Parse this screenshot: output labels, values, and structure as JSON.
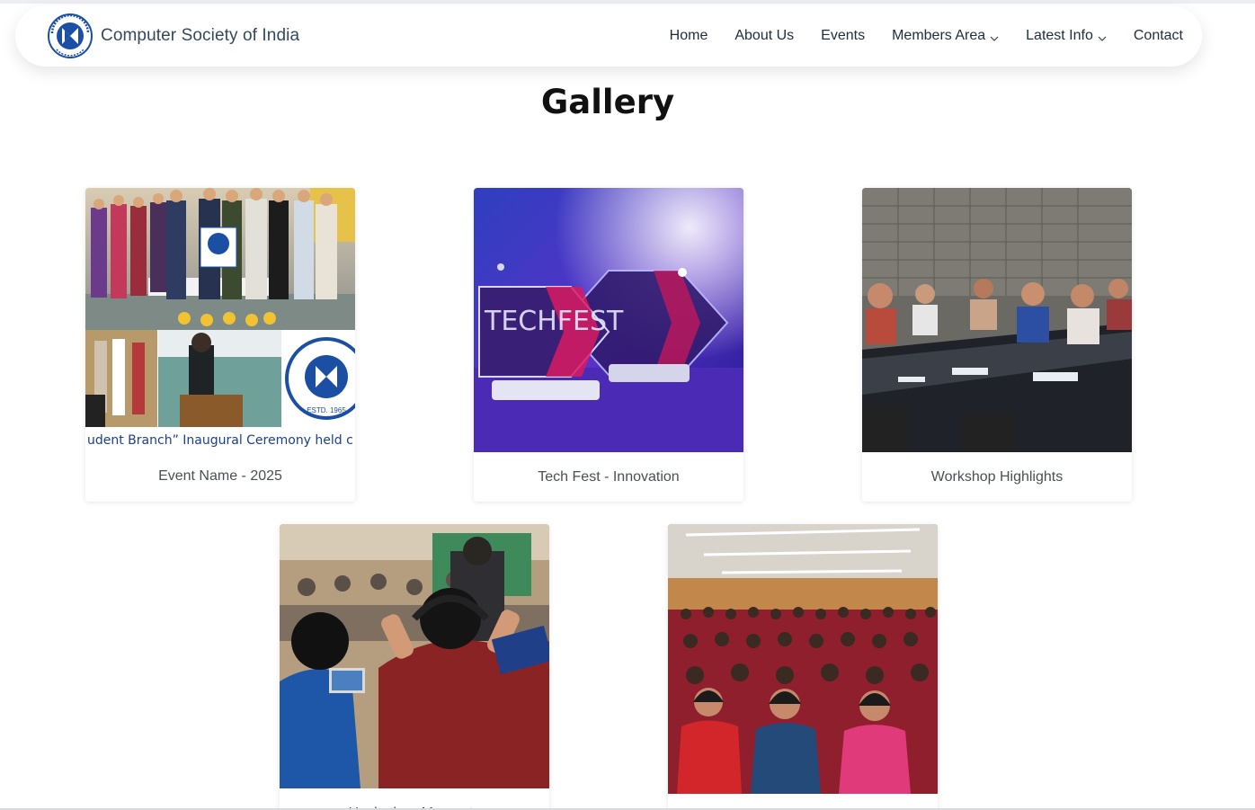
{
  "page": {
    "heading": "Gallery"
  },
  "navbar": {
    "brand": "Computer Society of India",
    "logo_icon": "csi-logo-icon",
    "items": [
      {
        "label": "Home",
        "dropdown": false
      },
      {
        "label": "About Us",
        "dropdown": false
      },
      {
        "label": "Events",
        "dropdown": false
      },
      {
        "label": "Members Area",
        "dropdown": true
      },
      {
        "label": "Latest Info",
        "dropdown": true
      },
      {
        "label": "Contact",
        "dropdown": false
      }
    ]
  },
  "gallery": [
    {
      "caption": "Event Name - 2025",
      "banner_text": "udent Branch” Inaugural Ceremony held c",
      "stamp": "ESTD. 1965"
    },
    {
      "caption": "Tech Fest - Innovation",
      "sign_text": "TECHFEST"
    },
    {
      "caption": "Workshop Highlights"
    },
    {
      "caption": "Hackathon Moments"
    },
    {
      "caption": ""
    }
  ],
  "colors": {
    "brand_text": "#34495e",
    "heading": "#111111",
    "caption": "#4a4f55",
    "csi_blue": "#1b4fa3"
  }
}
